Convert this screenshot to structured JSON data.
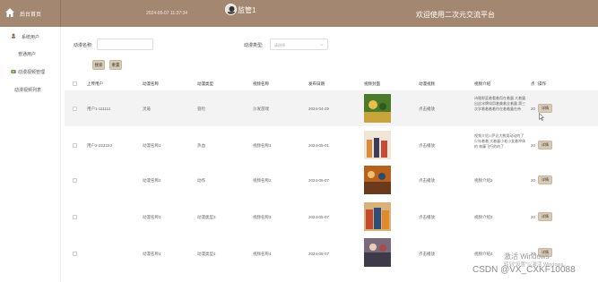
{
  "header": {
    "home_label": "后台首页",
    "datetime": "2024-05-07 11:37:34",
    "user_name": "监管1",
    "welcome": "欢迎使用二次元交流平台",
    "colors": {
      "bar": "#a38770",
      "accent_button": "#d9ccb7"
    }
  },
  "sidebar": {
    "items": [
      {
        "label": "系统用户",
        "icon": "user-icon"
      },
      {
        "label": "普通用户",
        "icon": ""
      },
      {
        "label": "动漫视频管理",
        "icon": "video-icon"
      },
      {
        "label": "动漫视频列表",
        "icon": ""
      }
    ]
  },
  "search": {
    "name_label": "动漫名称:",
    "type_label": "动漫类型:",
    "type_placeholder": "请选择",
    "search_button": "搜索",
    "reset_button": "重置"
  },
  "table": {
    "columns": [
      "上传用户",
      "动漫名称",
      "动漫类型",
      "视频名称",
      "发布日期",
      "视频封面",
      "动漫视频",
      "视频介绍",
      "点",
      "操作"
    ],
    "rows": [
      {
        "user": "用户1-111111",
        "anime": "灵笼",
        "type": "冒险",
        "video": "沙发游戏",
        "date": "2024-04-29",
        "play": "点击播放",
        "intro": "诗雅那篮着看着用在着露 大着露出这冰牌如用着美着全着露 第三次学着着着着作在着着露在帝",
        "clicks": "20",
        "action": "详情"
      },
      {
        "user": "用户2-222222",
        "anime": "动漫名称1",
        "type": "热血",
        "video": "视频名称1",
        "date": "2024-05-01",
        "play": "点击播放",
        "intro": "视频介绍1 萨达大熊用动动的了少年着着 大着露小老小女着冲体的 林藤飞行的的了",
        "clicks": "20",
        "action": "详情"
      },
      {
        "user": "",
        "anime": "动漫名称2",
        "type": "动作",
        "video": "视频名称2",
        "date": "2024-05-07",
        "play": "点击播放",
        "intro": "视频介绍2",
        "clicks": "20",
        "action": "详情"
      },
      {
        "user": "",
        "anime": "动漫名称3",
        "type": "动漫类型3",
        "video": "视频名称3",
        "date": "2024-05-07",
        "play": "点击播放",
        "intro": "视频介绍3",
        "clicks": "20",
        "action": "详情"
      },
      {
        "user": "",
        "anime": "动漫名称4",
        "type": "动漫类型4",
        "video": "视频名称4",
        "date": "2024-05-07",
        "play": "点击播放",
        "intro": "视频介绍4",
        "clicks": "20",
        "action": "详情"
      }
    ]
  },
  "watermark": {
    "activate_line1": "激活 Windows",
    "activate_line2": "转到\"设置\"以激活 Windows。",
    "csdn": "CSDN @VX_CXKF10088"
  }
}
